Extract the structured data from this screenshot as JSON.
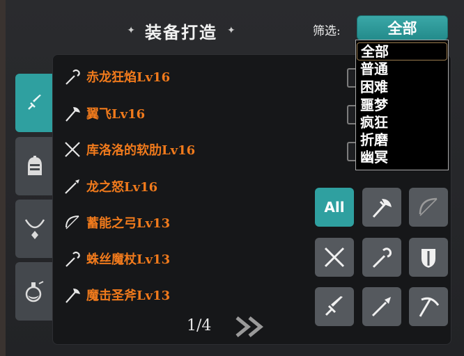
{
  "header": {
    "title": "装备打造",
    "filter_label": "筛选:",
    "filter_value": "全部"
  },
  "dropdown": {
    "options": [
      "全部",
      "普通",
      "困难",
      "噩梦",
      "疯狂",
      "折磨",
      "幽冥"
    ],
    "selected": "全部"
  },
  "side_tabs": [
    {
      "icon": "sword-icon",
      "active": true
    },
    {
      "icon": "helmet-icon",
      "active": false
    },
    {
      "icon": "necklace-icon",
      "active": false
    },
    {
      "icon": "potion-icon",
      "active": false
    }
  ],
  "items": [
    {
      "name": "赤龙狂焰Lv16",
      "icon": "staff-icon"
    },
    {
      "name": "翼飞Lv16",
      "icon": "axe-icon"
    },
    {
      "name": "库洛洛的软肋Lv16",
      "icon": "crossed-blades-icon"
    },
    {
      "name": "龙之怒Lv16",
      "icon": "spear-icon"
    },
    {
      "name": "蓄能之弓Lv13",
      "icon": "bow-icon"
    },
    {
      "name": "蛛丝魔杖Lv13",
      "icon": "staff-icon"
    },
    {
      "name": "魔击圣斧Lv13",
      "icon": "axe-icon"
    }
  ],
  "pagination": {
    "text": "1/4"
  },
  "weapon_types": [
    {
      "label": "All",
      "icon": "",
      "active": true
    },
    {
      "label": "",
      "icon": "axe-icon",
      "active": false
    },
    {
      "label": "",
      "icon": "bow-icon",
      "active": false
    },
    {
      "label": "",
      "icon": "crossed-blades-icon",
      "active": false
    },
    {
      "label": "",
      "icon": "staff-icon",
      "active": false
    },
    {
      "label": "",
      "icon": "shield-icon",
      "active": false
    },
    {
      "label": "",
      "icon": "sword-icon",
      "active": false
    },
    {
      "label": "",
      "icon": "spear-icon",
      "active": false
    },
    {
      "label": "",
      "icon": "pickaxe-icon",
      "active": false
    }
  ],
  "colors": {
    "accent": "#2fa0a0",
    "item_text": "#f07a1c"
  }
}
